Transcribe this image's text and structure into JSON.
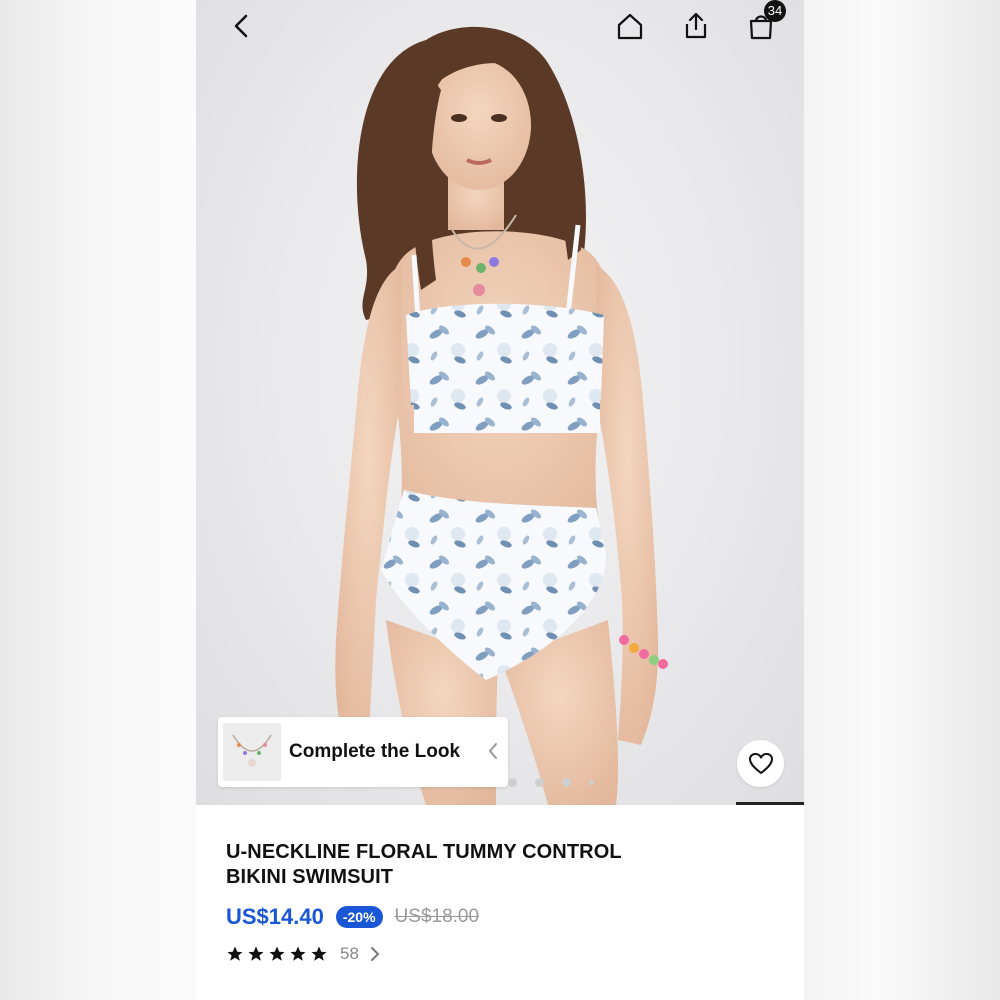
{
  "header": {
    "back_icon": "chevron-left-icon",
    "home_icon": "home-icon",
    "share_icon": "share-icon",
    "cart_icon": "shopping-bag-icon",
    "cart_count": "34"
  },
  "gallery": {
    "image": "model wearing white floral bikini swimsuit",
    "current_index": 1,
    "total_images": 5,
    "complete_the_look": {
      "label": "Complete the Look",
      "thumbnail": "necklace"
    },
    "wishlist_icon": "heart-icon"
  },
  "product": {
    "title_line1": "U-NECKLINE FLORAL TUMMY CONTROL",
    "title_line2": "BIKINI SWIMSUIT",
    "price": "US$14.40",
    "discount": "-20%",
    "original_price": "US$18.00",
    "rating": 5,
    "review_count": "58"
  },
  "colors": {
    "accent": "#1a57d6",
    "text": "#111111",
    "muted": "#9a9a9a"
  }
}
